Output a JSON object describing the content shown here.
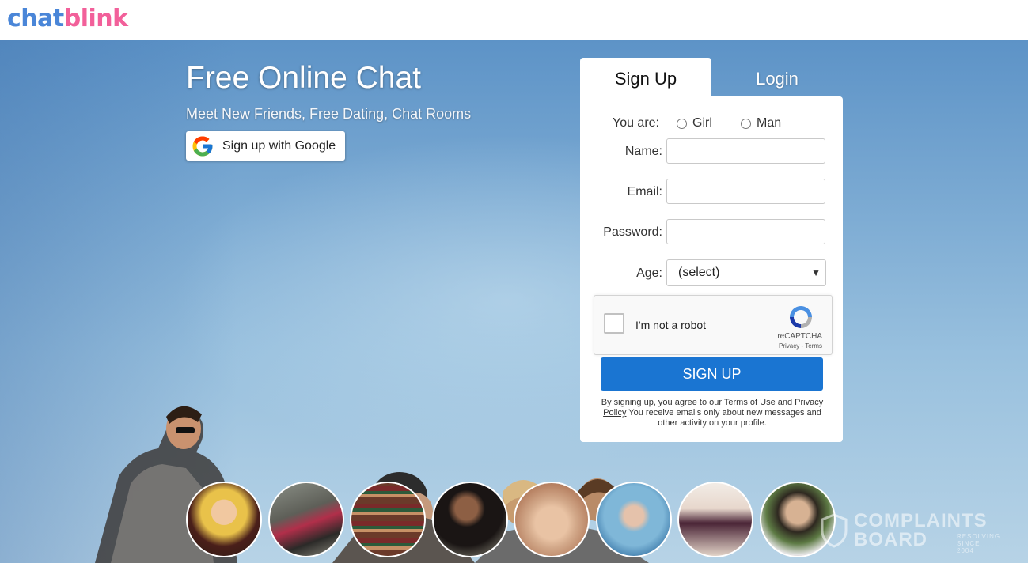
{
  "header": {
    "logo_part1": "chat",
    "logo_part2": "blink"
  },
  "hero": {
    "title": "Free Online Chat",
    "subtitle": "Meet New Friends, Free Dating, Chat Rooms",
    "google_button": "Sign up with Google"
  },
  "tabs": [
    {
      "label": "Sign Up",
      "active": true
    },
    {
      "label": "Login",
      "active": false
    }
  ],
  "form": {
    "you_are_label": "You are:",
    "gender_options": [
      "Girl",
      "Man"
    ],
    "name_label": "Name:",
    "name_value": "",
    "email_label": "Email:",
    "email_value": "",
    "password_label": "Password:",
    "password_value": "",
    "age_label": "Age:",
    "age_selected": "(select)",
    "captcha_text": "I'm not a robot",
    "captcha_brand": "reCAPTCHA",
    "captcha_links": "Privacy - Terms",
    "submit_label": "SIGN UP",
    "legal_prefix": "By signing up, you agree to our ",
    "terms_link": "Terms of Use",
    "legal_and": " and ",
    "privacy_link": "Privacy Policy",
    "legal_suffix": " You receive emails only about new messages and other activity on your profile."
  },
  "watermark": {
    "line1": "COMPLAINTS",
    "line2": "BOARD",
    "tag1": "RESOLVING",
    "tag2": "SINCE 2004"
  },
  "colors": {
    "logo_blue": "#4a86d8",
    "logo_pink": "#f2609a",
    "primary_button": "#1a75d2"
  }
}
